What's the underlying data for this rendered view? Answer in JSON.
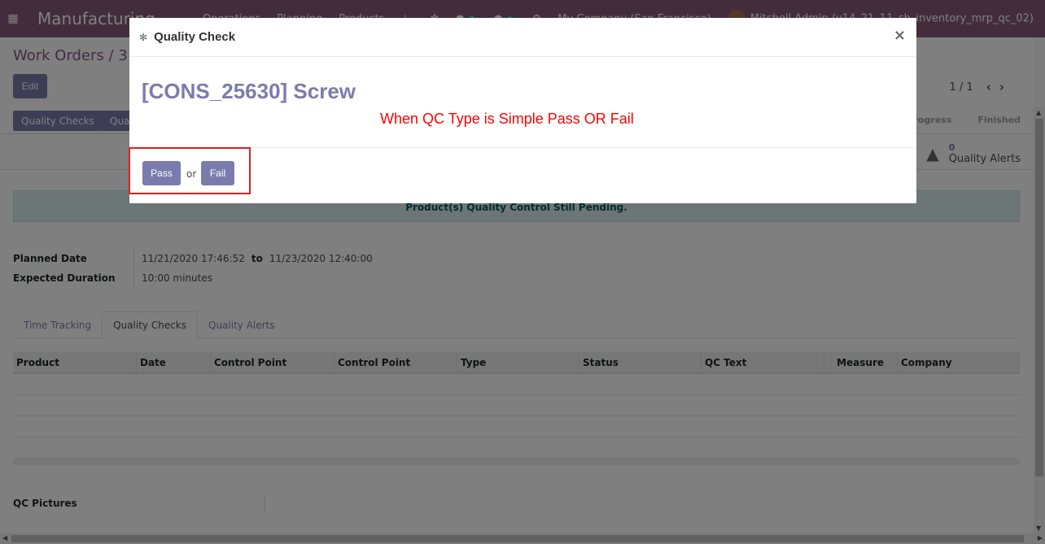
{
  "navbar": {
    "app_title": "Manufacturing",
    "menu": [
      "Operations",
      "Planning",
      "Products"
    ],
    "plus": "+",
    "chat_count": "7",
    "activity_count": "6",
    "company": "My Company (San Francisco)",
    "user": "Mitchell Admin (v14_21_11_sh_inventory_mrp_qc_02)"
  },
  "control": {
    "breadcrumb": "Work Orders / 3 -",
    "edit_label": "Edit",
    "pager_value": "1 / 1"
  },
  "statusbar": {
    "buttons": [
      "Quality Checks",
      "Qua"
    ],
    "stages": [
      "Progress",
      "Finished"
    ]
  },
  "button_box": {
    "quality_alerts_count": "0",
    "quality_alerts_label": "Quality Alerts"
  },
  "alert": {
    "text": "Product(s) Quality Control Still Pending."
  },
  "form": {
    "planned_date_label": "Planned Date",
    "planned_start": "11/21/2020 17:46:52",
    "to_label": "to",
    "planned_end": "11/23/2020 12:40:00",
    "expected_duration_label": "Expected Duration",
    "duration_value": "10:00",
    "duration_unit": "minutes"
  },
  "tabs": [
    "Time Tracking",
    "Quality Checks",
    "Quality Alerts"
  ],
  "table": {
    "columns": [
      "Product",
      "Date",
      "Control Point",
      "Control Point",
      "Type",
      "Status",
      "QC Text",
      "Measure",
      "Company"
    ]
  },
  "qc_pictures_label": "QC Pictures",
  "modal": {
    "title": "Quality Check",
    "product": "[CONS_25630] Screw",
    "note": "When QC Type is Simple Pass OR Fail",
    "pass_label": "Pass",
    "or_label": "or",
    "fail_label": "Fail",
    "close_symbol": "×"
  },
  "colors": {
    "brand": "#875a7b",
    "primary": "#7c7bad",
    "note_red": "#ff0000",
    "highlight_red": "#e02020"
  }
}
